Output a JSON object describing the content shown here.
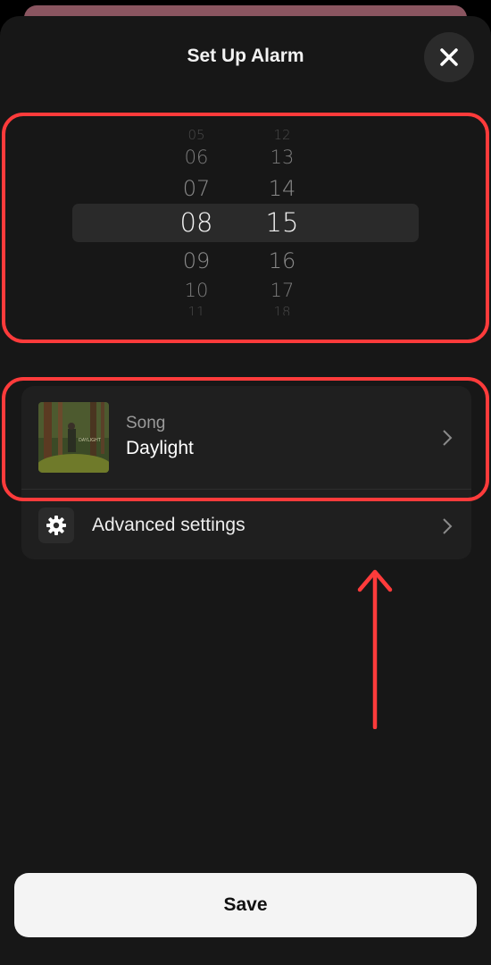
{
  "header": {
    "title": "Set Up Alarm",
    "close_icon": "close-icon"
  },
  "time_picker": {
    "hours": [
      "05",
      "06",
      "07",
      "08",
      "09",
      "10",
      "11"
    ],
    "minutes": [
      "12",
      "13",
      "14",
      "15",
      "16",
      "17",
      "18"
    ],
    "selected_hour": "08",
    "selected_minute": "15"
  },
  "song": {
    "label": "Song",
    "name": "Daylight",
    "icon": "album-art"
  },
  "advanced": {
    "label": "Advanced settings",
    "icon": "gear-icon"
  },
  "save_label": "Save",
  "colors": {
    "background": "#171717",
    "annotation": "#ff3b3b",
    "card": "#1f1f1f",
    "button": "#f4f4f4"
  }
}
